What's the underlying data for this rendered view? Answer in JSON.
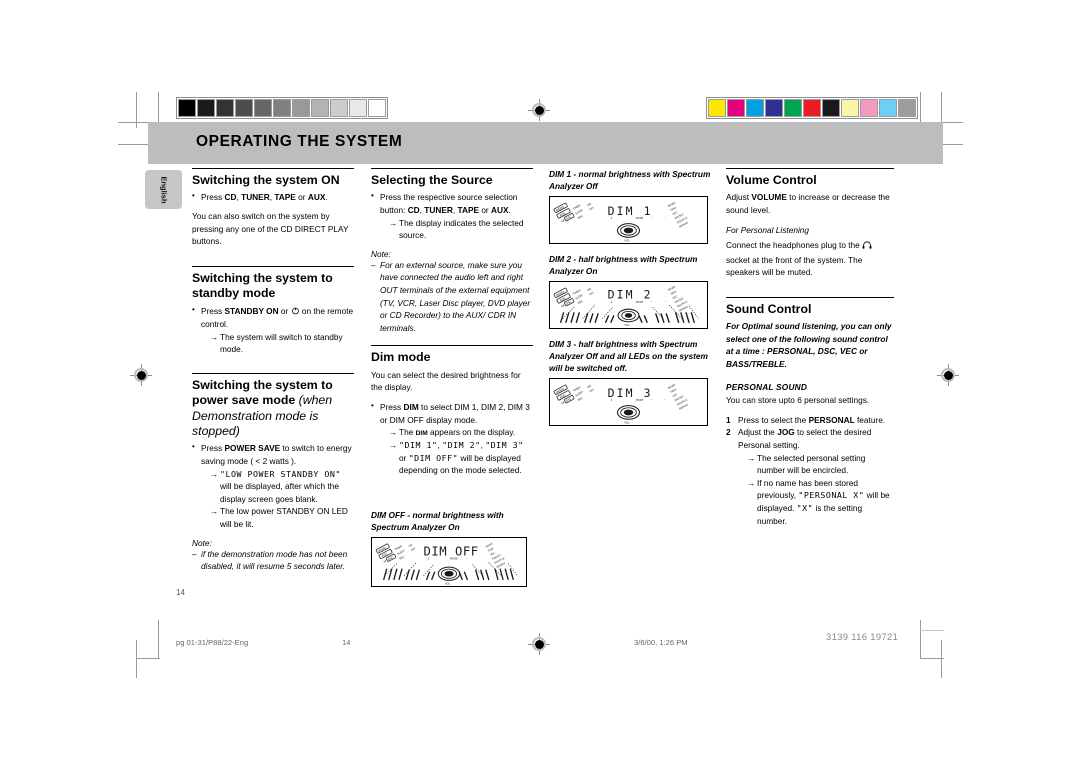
{
  "header": {
    "title": "OPERATING THE SYSTEM",
    "language_tab": "English"
  },
  "calibration": {
    "gray_swatches": [
      "#000000",
      "#1b1b1b",
      "#333333",
      "#4d4d4d",
      "#666666",
      "#808080",
      "#999999",
      "#b3b3b3",
      "#cccccc",
      "#e8e8e8",
      "#ffffff"
    ],
    "color_swatches": [
      "#ffe800",
      "#e5007e",
      "#00a0e4",
      "#2e3192",
      "#00a551",
      "#ed1c24",
      "#1a1a1a",
      "#fdf3a8",
      "#f49ac1",
      "#6dcff6",
      "#9c9c9c"
    ]
  },
  "col1": {
    "s1_title": "Switching the system ON",
    "s1_b1_pre": "Press ",
    "s1_b1_keys1": "CD",
    "s1_b1_sep1": ", ",
    "s1_b1_keys2": "TUNER",
    "s1_b1_sep2": ", ",
    "s1_b1_keys3": "TAPE",
    "s1_b1_sep3": " or ",
    "s1_b1_keys4": "AUX",
    "s1_b1_end": ".",
    "s1_p1": "You can also switch on the system by pressing any one of the CD DIRECT PLAY buttons.",
    "s2_title": "Switching the system to standby mode",
    "s2_b1_pre": "Press ",
    "s2_b1_key": "STANDBY ON",
    "s2_b1_mid": " or ",
    "s2_b1_icon": "power-icon",
    "s2_b1_end": " on the remote control.",
    "s2_a1": "The system will switch to standby mode.",
    "s3_title_a": "Switching the system to power save mode",
    "s3_title_b": " (when Demonstration mode is stopped)",
    "s3_b1_pre": "Press ",
    "s3_b1_key": "POWER SAVE",
    "s3_b1_end": " to switch to energy saving mode ( < 2 watts ).",
    "s3_a1_lcd": "\"LOW POWER STANDBY ON\"",
    "s3_a1_rest": " will be displayed, after which the display screen goes blank.",
    "s3_a2": "The low power STANDBY ON LED will be lit.",
    "note_label": "Note:",
    "note_1": "if the demonstration mode has not been disabled, it will resume 5 seconds later."
  },
  "col2": {
    "s1_title": "Selecting the Source",
    "s1_b1_pre": "Press the respective source selection button: ",
    "s1_b1_k1": "CD",
    "s1_b1_k2": "TUNER",
    "s1_b1_k3": "TAPE",
    "s1_b1_k4": "AUX",
    "s1_b1_sep": ", ",
    "s1_b1_or": " or ",
    "s1_b1_end": ".",
    "s1_a1": "The display indicates the selected source.",
    "note_label": "Note:",
    "note_1": "For an external source, make sure you have connected the audio left and right OUT terminals of the external equipment (TV, VCR, Laser Disc player, DVD player or CD Recorder) to the AUX/ CDR IN terminals.",
    "s2_title": "Dim mode",
    "s2_p1": "You can select the desired brightness for the display.",
    "s2_b1_pre": "Press ",
    "s2_b1_key": "DIM",
    "s2_b1_end": " to select DIM 1, DIM 2, DIM 3 or DIM OFF display mode.",
    "s2_a1_pre": "The ",
    "s2_a1_key": "DIM",
    "s2_a1_end": " appears on the display.",
    "s2_a2_lcd1": "\"DIM 1\"",
    "s2_a2_sep1": ", ",
    "s2_a2_lcd2": "\"DIM 2\"",
    "s2_a2_sep2": ", ",
    "s2_a2_lcd3": "\"DIM 3\"",
    "s2_a2_or": " or ",
    "s2_a2_lcd4": "\"DIM OFF\"",
    "s2_a2_end": " will be displayed depending on the mode selected.",
    "cap_dimoff": "DIM OFF - normal brightness with Spectrum Analyzer On",
    "lcd_dimoff_text": "DIM OFF"
  },
  "col3": {
    "cap_dim1": "DIM 1 - normal brightness with Spectrum Analyzer Off",
    "lcd_dim1_text": "DIM 1",
    "cap_dim2": "DIM 2 - half brightness with Spectrum Analyzer On",
    "lcd_dim2_text": "DIM 2",
    "cap_dim3": "DIM 3 - half brightness with Spectrum Analyzer Off and all LEDs on the system will be switched off.",
    "lcd_dim3_text": "DIM 3"
  },
  "col4": {
    "s1_title": "Volume Control",
    "s1_p1_pre": "Adjust ",
    "s1_p1_key": "VOLUME",
    "s1_p1_end": " to increase or decrease the sound level.",
    "s1_sub": "For Personal Listening",
    "s1_p2_pre": "Connect the headphones plug to the ",
    "s1_p2_icon": "headphones-icon",
    "s1_p2_end": " socket at the front of the system. The speakers will be muted.",
    "s2_title": "Sound Control",
    "s2_intro": "For Optimal sound listening, you can only select one of the following sound control at a time : PERSONAL, DSC, VEC or BASS/TREBLE.",
    "s2_sub": "PERSONAL SOUND",
    "s2_p1": "You can store upto 6 personal settings.",
    "s2_n1_num": "1",
    "s2_n1_pre": "Press to select the ",
    "s2_n1_key": "PERSONAL",
    "s2_n1_end": " feature.",
    "s2_n2_num": "2",
    "s2_n2_pre": "Adjust the ",
    "s2_n2_key": "JOG",
    "s2_n2_end": " to select the desired Personal setting.",
    "s2_a1": "The selected personal setting number will be encircled.",
    "s2_a2_pre": "If no name has been stored previously, ",
    "s2_a2_lcd": "\"PERSONAL X\"",
    "s2_a2_mid": " will be displayed. ",
    "s2_a2_lcd2": "\"X\"",
    "s2_a2_end": " is the setting number."
  },
  "page": {
    "number": "14"
  },
  "footer": {
    "file": "pg 01-31/P88/22-Eng",
    "page": "14",
    "timestamp": "3/6/00, 1:26 PM",
    "code": "3139 116 19721"
  },
  "lcd_labels": {
    "left_top": [
      "DEMO",
      "TIMER",
      "ON"
    ],
    "left_mid": [
      "SLEEP",
      "REC",
      "OFF"
    ],
    "left_bot": [
      "RDS",
      "DSC"
    ],
    "right": [
      "NEWS",
      "TRAF",
      "VEC",
      "PRESET",
      "SHUFFLE",
      "REPEAT"
    ],
    "center_small": "MODE"
  }
}
